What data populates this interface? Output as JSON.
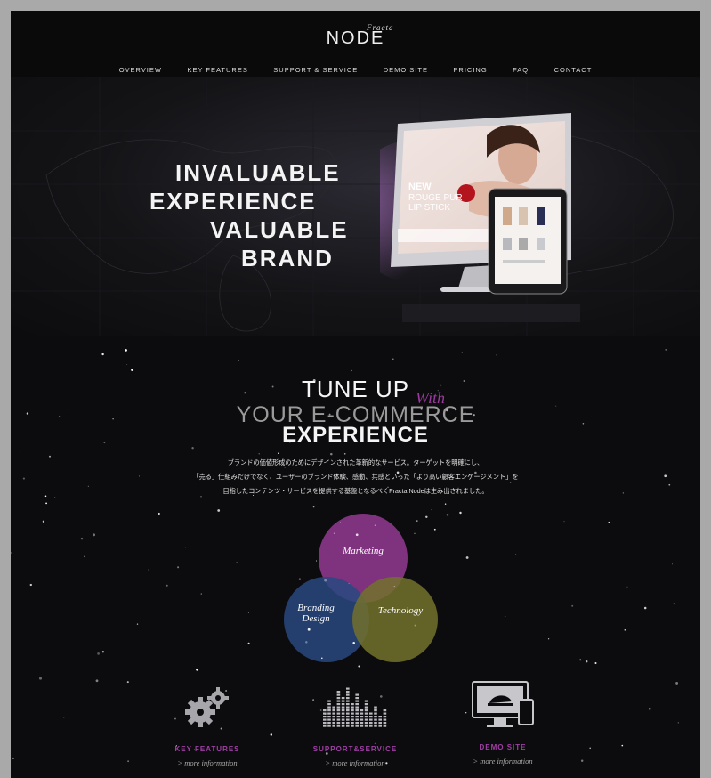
{
  "brand": {
    "logo_small": "Fracta",
    "logo_big": "NODE"
  },
  "nav": [
    "OVERVIEW",
    "KEY FEATURES",
    "SUPPORT & SERVICE",
    "DEMO SITE",
    "PRICING",
    "FAQ",
    "CONTACT"
  ],
  "hero": {
    "headline": [
      "INVALUABLE",
      "EXPERIENCE",
      "VALUABLE",
      "BRAND"
    ],
    "ad_text": [
      "NEW",
      "ROUGE PUR",
      "LIP STICK"
    ]
  },
  "tagline": {
    "line1": "TUNE UP",
    "with": "With",
    "line2": "YOUR E-COMMERCE",
    "line3": "EXPERIENCE"
  },
  "intro": [
    "ブランドの価値形成のためにデザインされた革新的なサービス。ターゲットを明確にし、",
    "「売る」仕組みだけでなく、ユーザーのブランド体験、感動、共感といった「より高い顧客エンゲージメント」を",
    "目指したコンテンツ・サービスを提供する基盤となるべくFracta Nodeは生み出されました。"
  ],
  "venn": {
    "marketing": "Marketing",
    "branding_line1": "Branding",
    "branding_line2": "Design",
    "technology": "Technology",
    "colors": {
      "marketing": "#8e2f8c",
      "branding": "#1d3f78",
      "technology": "#6b6a1e"
    }
  },
  "features": [
    {
      "label": "KEY FEATURES",
      "more": "> more information",
      "icon": "gears-icon"
    },
    {
      "label": "SUPPORT&SERVICE",
      "more": "> more information",
      "icon": "equalizer-icon"
    },
    {
      "label": "DEMO SITE",
      "more": "> more information",
      "icon": "devices-icon"
    }
  ],
  "colors": {
    "accent": "#a13ea6",
    "background": "#0c0c0e"
  }
}
